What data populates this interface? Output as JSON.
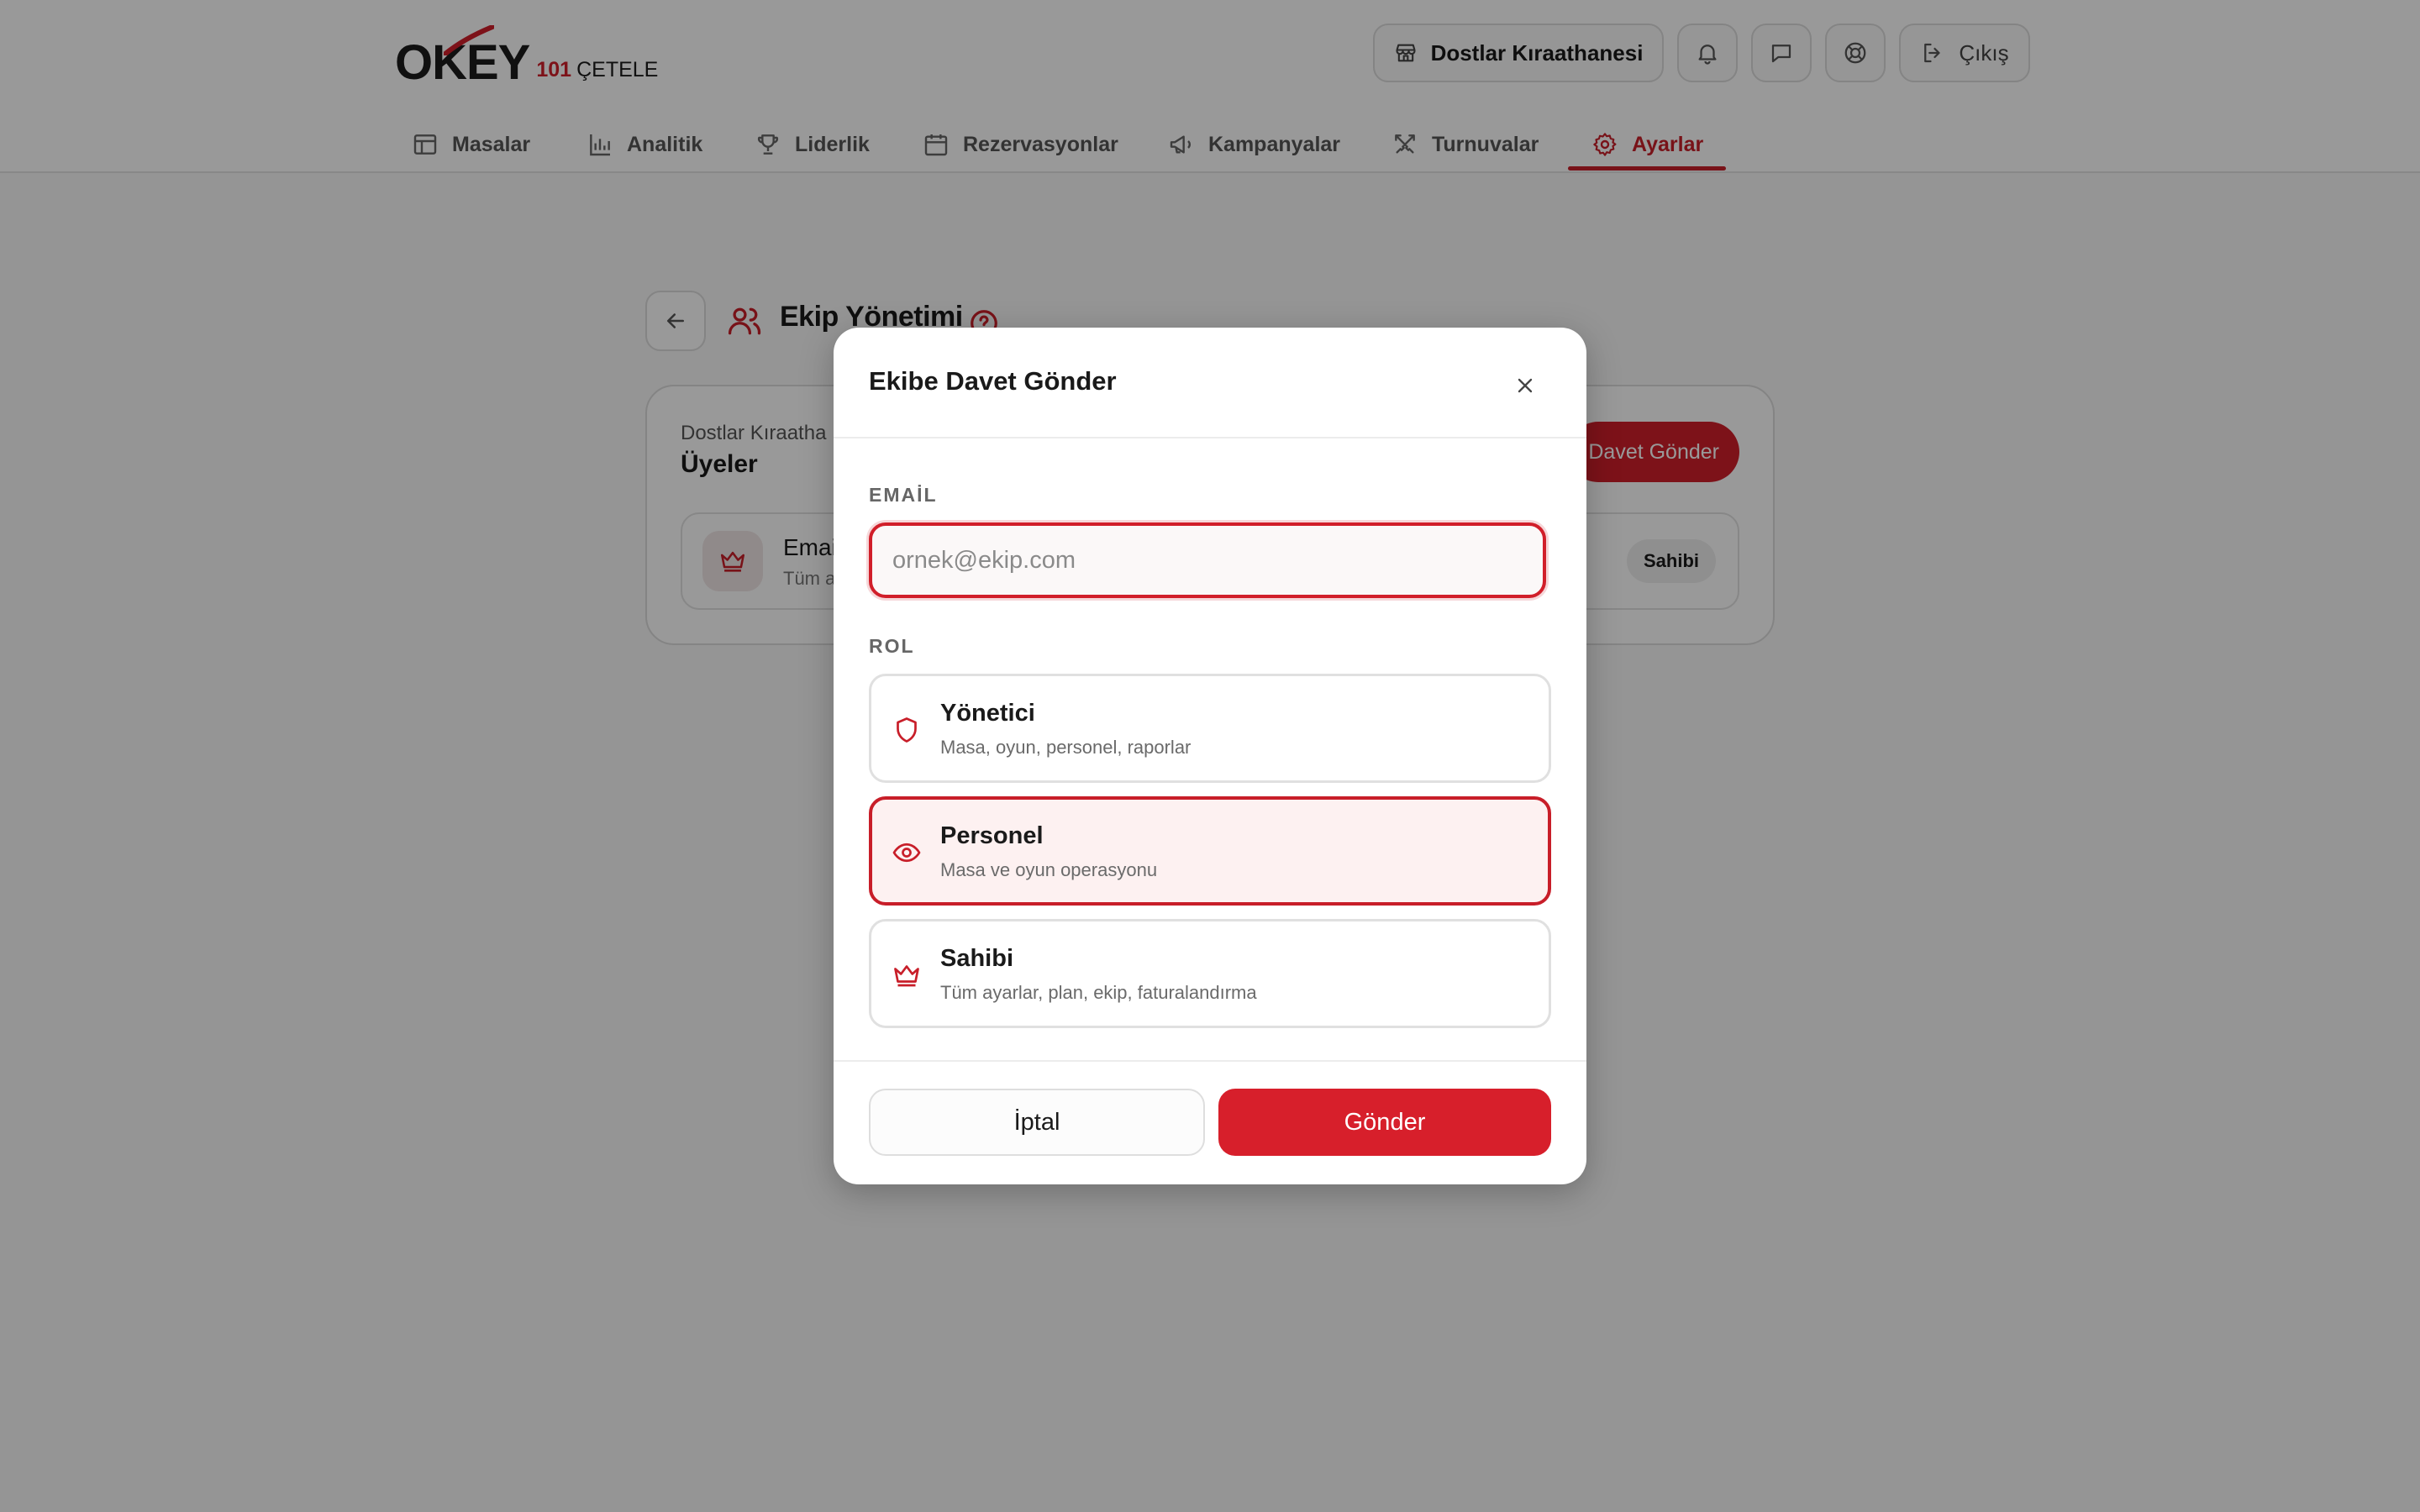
{
  "header": {
    "logo_main": "OKEY",
    "logo_num": "101",
    "logo_sub": "ÇETELE",
    "venue_label": "Dostlar Kıraathanesi",
    "exit_label": "Çıkış"
  },
  "nav": {
    "items": [
      {
        "label": "Masalar",
        "icon": "table-icon"
      },
      {
        "label": "Analitik",
        "icon": "bar-chart-icon"
      },
      {
        "label": "Liderlik",
        "icon": "trophy-icon"
      },
      {
        "label": "Rezervasyonlar",
        "icon": "calendar-icon"
      },
      {
        "label": "Kampanyalar",
        "icon": "megaphone-icon"
      },
      {
        "label": "Turnuvalar",
        "icon": "swords-icon"
      },
      {
        "label": "Ayarlar",
        "icon": "gear-icon"
      }
    ],
    "active": "Ayarlar"
  },
  "page": {
    "title": "Ekip Yönetimi",
    "card_subtitle": "Dostlar Kıraatha",
    "card_title": "Üyeler",
    "invite_button": "Davet Gönder",
    "member_name": "Emai",
    "member_sub": "Tüm a",
    "member_badge": "Sahibi"
  },
  "modal": {
    "title": "Ekibe Davet Gönder",
    "email_label": "EMAİL",
    "email_placeholder": "ornek@ekip.com",
    "email_value": "",
    "role_label": "ROL",
    "roles": [
      {
        "name": "Yönetici",
        "desc": "Masa, oyun, personel, raporlar",
        "icon": "shield-icon",
        "selected": false
      },
      {
        "name": "Personel",
        "desc": "Masa ve oyun operasyonu",
        "icon": "eye-icon",
        "selected": true
      },
      {
        "name": "Sahibi",
        "desc": "Tüm ayarlar, plan, ekip, faturalandırma",
        "icon": "crown-icon",
        "selected": false
      }
    ],
    "cancel_label": "İptal",
    "send_label": "Gönder"
  },
  "colors": {
    "accent": "#d11f2a",
    "selected_bg": "#fdf1f1",
    "overlay": "rgba(0,0,0,0.40)"
  }
}
